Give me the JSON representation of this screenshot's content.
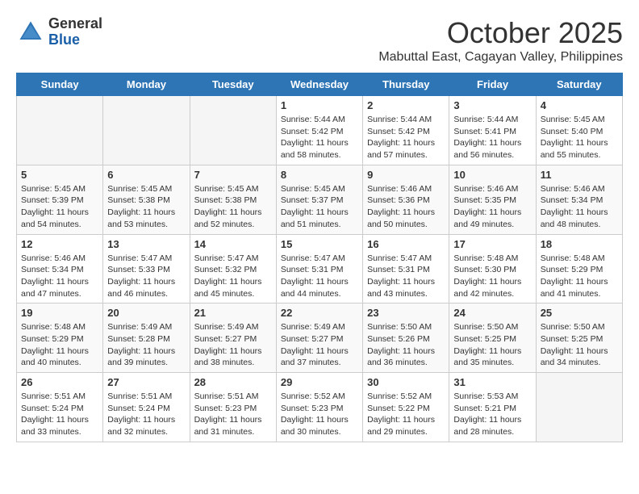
{
  "header": {
    "logo_general": "General",
    "logo_blue": "Blue",
    "month": "October 2025",
    "location": "Mabuttal East, Cagayan Valley, Philippines"
  },
  "weekdays": [
    "Sunday",
    "Monday",
    "Tuesday",
    "Wednesday",
    "Thursday",
    "Friday",
    "Saturday"
  ],
  "weeks": [
    [
      {
        "day": "",
        "info": ""
      },
      {
        "day": "",
        "info": ""
      },
      {
        "day": "",
        "info": ""
      },
      {
        "day": "1",
        "info": "Sunrise: 5:44 AM\nSunset: 5:42 PM\nDaylight: 11 hours\nand 58 minutes."
      },
      {
        "day": "2",
        "info": "Sunrise: 5:44 AM\nSunset: 5:42 PM\nDaylight: 11 hours\nand 57 minutes."
      },
      {
        "day": "3",
        "info": "Sunrise: 5:44 AM\nSunset: 5:41 PM\nDaylight: 11 hours\nand 56 minutes."
      },
      {
        "day": "4",
        "info": "Sunrise: 5:45 AM\nSunset: 5:40 PM\nDaylight: 11 hours\nand 55 minutes."
      }
    ],
    [
      {
        "day": "5",
        "info": "Sunrise: 5:45 AM\nSunset: 5:39 PM\nDaylight: 11 hours\nand 54 minutes."
      },
      {
        "day": "6",
        "info": "Sunrise: 5:45 AM\nSunset: 5:38 PM\nDaylight: 11 hours\nand 53 minutes."
      },
      {
        "day": "7",
        "info": "Sunrise: 5:45 AM\nSunset: 5:38 PM\nDaylight: 11 hours\nand 52 minutes."
      },
      {
        "day": "8",
        "info": "Sunrise: 5:45 AM\nSunset: 5:37 PM\nDaylight: 11 hours\nand 51 minutes."
      },
      {
        "day": "9",
        "info": "Sunrise: 5:46 AM\nSunset: 5:36 PM\nDaylight: 11 hours\nand 50 minutes."
      },
      {
        "day": "10",
        "info": "Sunrise: 5:46 AM\nSunset: 5:35 PM\nDaylight: 11 hours\nand 49 minutes."
      },
      {
        "day": "11",
        "info": "Sunrise: 5:46 AM\nSunset: 5:34 PM\nDaylight: 11 hours\nand 48 minutes."
      }
    ],
    [
      {
        "day": "12",
        "info": "Sunrise: 5:46 AM\nSunset: 5:34 PM\nDaylight: 11 hours\nand 47 minutes."
      },
      {
        "day": "13",
        "info": "Sunrise: 5:47 AM\nSunset: 5:33 PM\nDaylight: 11 hours\nand 46 minutes."
      },
      {
        "day": "14",
        "info": "Sunrise: 5:47 AM\nSunset: 5:32 PM\nDaylight: 11 hours\nand 45 minutes."
      },
      {
        "day": "15",
        "info": "Sunrise: 5:47 AM\nSunset: 5:31 PM\nDaylight: 11 hours\nand 44 minutes."
      },
      {
        "day": "16",
        "info": "Sunrise: 5:47 AM\nSunset: 5:31 PM\nDaylight: 11 hours\nand 43 minutes."
      },
      {
        "day": "17",
        "info": "Sunrise: 5:48 AM\nSunset: 5:30 PM\nDaylight: 11 hours\nand 42 minutes."
      },
      {
        "day": "18",
        "info": "Sunrise: 5:48 AM\nSunset: 5:29 PM\nDaylight: 11 hours\nand 41 minutes."
      }
    ],
    [
      {
        "day": "19",
        "info": "Sunrise: 5:48 AM\nSunset: 5:29 PM\nDaylight: 11 hours\nand 40 minutes."
      },
      {
        "day": "20",
        "info": "Sunrise: 5:49 AM\nSunset: 5:28 PM\nDaylight: 11 hours\nand 39 minutes."
      },
      {
        "day": "21",
        "info": "Sunrise: 5:49 AM\nSunset: 5:27 PM\nDaylight: 11 hours\nand 38 minutes."
      },
      {
        "day": "22",
        "info": "Sunrise: 5:49 AM\nSunset: 5:27 PM\nDaylight: 11 hours\nand 37 minutes."
      },
      {
        "day": "23",
        "info": "Sunrise: 5:50 AM\nSunset: 5:26 PM\nDaylight: 11 hours\nand 36 minutes."
      },
      {
        "day": "24",
        "info": "Sunrise: 5:50 AM\nSunset: 5:25 PM\nDaylight: 11 hours\nand 35 minutes."
      },
      {
        "day": "25",
        "info": "Sunrise: 5:50 AM\nSunset: 5:25 PM\nDaylight: 11 hours\nand 34 minutes."
      }
    ],
    [
      {
        "day": "26",
        "info": "Sunrise: 5:51 AM\nSunset: 5:24 PM\nDaylight: 11 hours\nand 33 minutes."
      },
      {
        "day": "27",
        "info": "Sunrise: 5:51 AM\nSunset: 5:24 PM\nDaylight: 11 hours\nand 32 minutes."
      },
      {
        "day": "28",
        "info": "Sunrise: 5:51 AM\nSunset: 5:23 PM\nDaylight: 11 hours\nand 31 minutes."
      },
      {
        "day": "29",
        "info": "Sunrise: 5:52 AM\nSunset: 5:23 PM\nDaylight: 11 hours\nand 30 minutes."
      },
      {
        "day": "30",
        "info": "Sunrise: 5:52 AM\nSunset: 5:22 PM\nDaylight: 11 hours\nand 29 minutes."
      },
      {
        "day": "31",
        "info": "Sunrise: 5:53 AM\nSunset: 5:21 PM\nDaylight: 11 hours\nand 28 minutes."
      },
      {
        "day": "",
        "info": ""
      }
    ]
  ]
}
